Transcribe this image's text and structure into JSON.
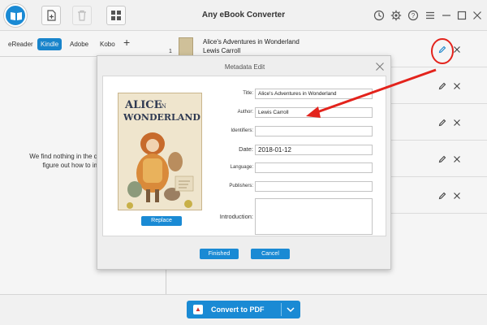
{
  "app": {
    "title": "Any eBook Converter"
  },
  "toolbar": {
    "buttons": [
      {
        "name": "add-book-button",
        "icon": "add-file-icon"
      },
      {
        "name": "delete-button",
        "icon": "trash-icon",
        "enabled": false
      },
      {
        "name": "grid-view-button",
        "icon": "grid-icon"
      }
    ],
    "window_icons": [
      "history-icon",
      "gear-icon",
      "help-icon",
      "menu-icon",
      "minimize-icon",
      "maximize-icon",
      "close-icon"
    ]
  },
  "device_tabs": {
    "tabs": [
      "eReader",
      "Kindle",
      "Adobe",
      "Kobo"
    ],
    "active": "Kindle",
    "add_label": "+"
  },
  "left_panel": {
    "empty_line1": "We find nothing in the default eBooks",
    "empty_line2": "figure out how to import eBo"
  },
  "book_list": {
    "rows": [
      {
        "number": "1",
        "title": "Alice's Adventures in Wonderland",
        "author": "Lewis Carroll"
      },
      {
        "number": "",
        "title": "",
        "author": ""
      },
      {
        "number": "",
        "title": "",
        "author": ""
      },
      {
        "number": "",
        "title": "",
        "author": ""
      },
      {
        "number": "",
        "title": "",
        "author": ""
      }
    ]
  },
  "modal": {
    "title": "Metadata Edit",
    "cover_text": {
      "line1": "ALICE",
      "line2": "IN",
      "line3": "WONDERLAND"
    },
    "replace_label": "Replace",
    "fields": {
      "title_label": "Title:",
      "title_value": "Alice's Adventures in Wonderland",
      "author_label": "Author:",
      "author_value": "Lewis Carroll",
      "identifiers_label": "Identifiers:",
      "identifiers_value": "",
      "date_label": "Date:",
      "date_value": "2018-01-12",
      "language_label": "Language:",
      "language_value": "",
      "publishers_label": "Publishers:",
      "publishers_value": "",
      "introduction_label": "Introduction:",
      "introduction_value": ""
    },
    "finished_label": "Finished",
    "cancel_label": "Cancel"
  },
  "bottom_bar": {
    "convert_label": "Convert to PDF",
    "convert_icon": "pdf-icon"
  },
  "colors": {
    "accent": "#1a8ad4",
    "annotation": "#e3231c",
    "titlebar_bg": "#f1f1f1"
  }
}
